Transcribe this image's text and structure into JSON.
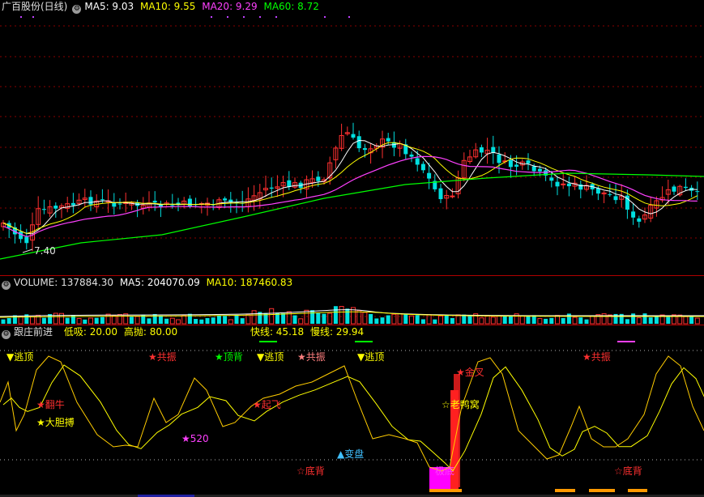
{
  "price": {
    "title": "广百股份(日线)",
    "ma5": "MA5: 9.03",
    "ma10": "MA10: 9.55",
    "ma20": "MA20: 9.29",
    "ma60": "MA60: 8.72",
    "low_label": "7.40"
  },
  "volume": {
    "title": "VOLUME: 137884.30",
    "ma5": "MA5: 204070.09",
    "ma10": "MA10: 187460.83"
  },
  "indicator": {
    "title": "跟庄前进",
    "low_buy": "低吸: 20.00",
    "high_sell": "高抛: 80.00",
    "fast": "快线: 45.18",
    "slow": "慢线: 29.94",
    "signals": [
      {
        "sym": "▼",
        "text": "逃顶",
        "color": "#ffff00"
      },
      {
        "sym": "★",
        "text": "共振",
        "color": "#ff3030"
      },
      {
        "sym": "★",
        "text": "顶背",
        "color": "#00ff00"
      },
      {
        "sym": "▼",
        "text": "逃顶",
        "color": "#ffff00"
      },
      {
        "sym": "★",
        "text": "共振",
        "color": "#ff8080"
      },
      {
        "sym": "▼",
        "text": "逃顶",
        "color": "#ffff00"
      },
      {
        "sym": "★",
        "text": "共振",
        "color": "#ff3030"
      },
      {
        "sym": "★",
        "text": "翻牛",
        "color": "#ff3030"
      },
      {
        "sym": "★",
        "text": "大胆搏",
        "color": "#ffff00"
      },
      {
        "sym": "★",
        "text": "520",
        "color": "#ff40ff"
      },
      {
        "sym": "★",
        "text": "起飞",
        "color": "#ff3030"
      },
      {
        "sym": "★",
        "text": "金叉",
        "color": "#ff3030"
      },
      {
        "sym": "☆",
        "text": "老鸭窝",
        "color": "#ffff00"
      },
      {
        "sym": "▲",
        "text": "变盘",
        "color": "#40c0ff"
      },
      {
        "sym": "☆",
        "text": "底背",
        "color": "#ff3030"
      },
      {
        "sym": "",
        "text": "极底",
        "color": "#ff40ff"
      },
      {
        "sym": "☆",
        "text": "底背",
        "color": "#ff3030"
      }
    ],
    "colors": {
      "fast": "#ffffff",
      "slow": "#ffff00",
      "red": "#ff2020",
      "magenta": "#ff00ff",
      "orange": "#ff9900"
    }
  }
}
